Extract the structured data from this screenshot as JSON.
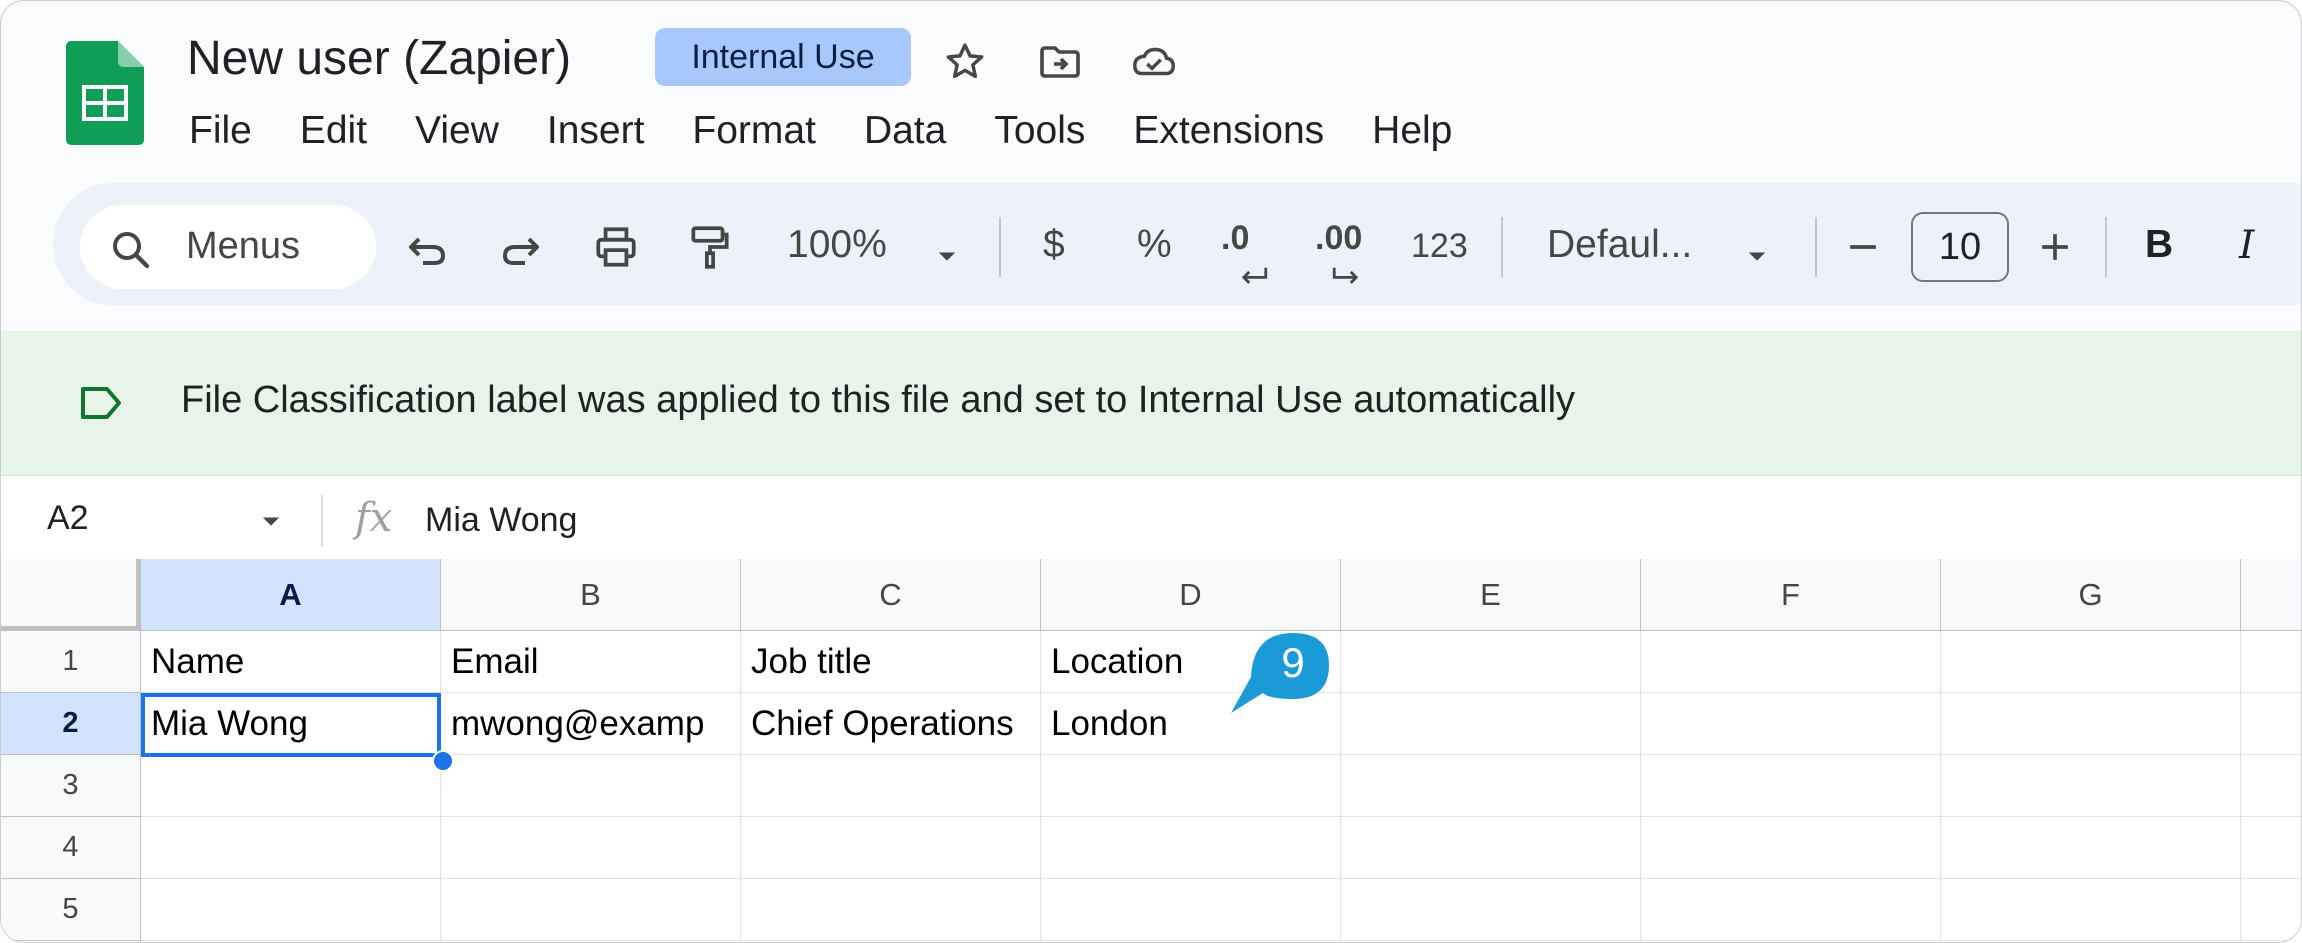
{
  "header": {
    "title": "New user (Zapier)",
    "label_chip": "Internal Use",
    "icons": [
      "star-icon",
      "move-to-folder-icon",
      "cloud-status-icon"
    ]
  },
  "menubar": {
    "items": [
      "File",
      "Edit",
      "View",
      "Insert",
      "Format",
      "Data",
      "Tools",
      "Extensions",
      "Help"
    ]
  },
  "toolbar": {
    "search_placeholder": "Menus",
    "zoom": "100%",
    "currency": "$",
    "percent": "%",
    "decrease_decimal": ".0",
    "increase_decimal": ".00",
    "number_format": "123",
    "font": "Defaul...",
    "font_size": "10",
    "bold": "B",
    "italic": "I"
  },
  "banner": {
    "text": "File Classification label was applied to this file and set to Internal Use automatically"
  },
  "formula_bar": {
    "cell_ref": "A2",
    "fx": "fx",
    "value": "Mia Wong"
  },
  "sheet": {
    "columns": [
      "A",
      "B",
      "C",
      "D",
      "E",
      "F",
      "G"
    ],
    "rows": [
      "1",
      "2",
      "3",
      "4",
      "5"
    ],
    "cells": [
      [
        "Name",
        "Email",
        "Job title",
        "Location"
      ],
      [
        "Mia Wong",
        "mwong@examp",
        "Chief Operations",
        "London"
      ]
    ],
    "selected_cell": "A2"
  },
  "step_badge": "9",
  "colors": {
    "accent": "#1a73e8",
    "chip": "#a8c7fa",
    "banner": "#e6f4ea",
    "sheets_green": "#0f9d58"
  }
}
